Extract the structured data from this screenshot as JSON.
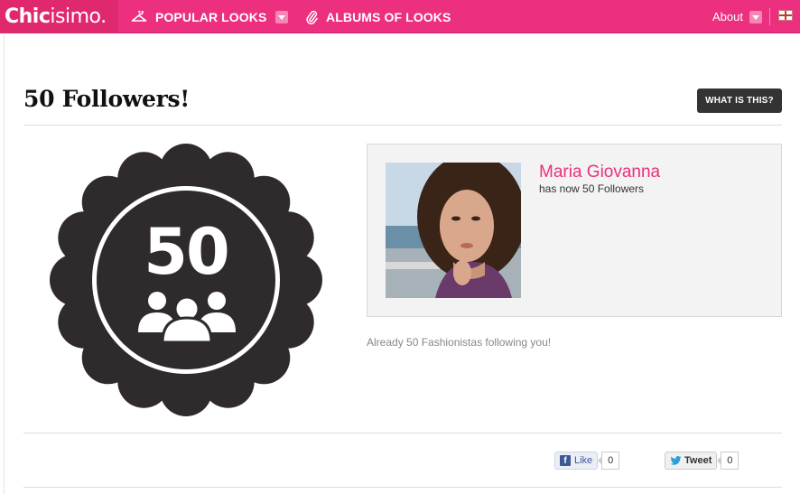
{
  "header": {
    "logo_bold": "Chic",
    "logo_light": "isimo.",
    "nav": [
      {
        "label": "POPULAR LOOKS",
        "icon": "hanger-icon"
      },
      {
        "label": "ALBUMS OF LOOKS",
        "icon": "paperclip-icon"
      }
    ],
    "about_label": "About"
  },
  "page": {
    "title": "50 Followers!",
    "what_button": "WHAT IS THIS?"
  },
  "badge": {
    "number": "50",
    "icon": "followers-icon",
    "color": "#2f2b2c"
  },
  "card": {
    "name": "Maria Giovanna",
    "subtitle": "has now 50 Followers",
    "photo_alt": "profile-photo"
  },
  "message": "Already 50 Fashionistas following you!",
  "share": {
    "like_label": "Like",
    "like_count": "0",
    "tweet_label": "Tweet",
    "tweet_count": "0"
  },
  "colors": {
    "brand": "#ec2f7e",
    "brand_dark": "#e0286f"
  }
}
